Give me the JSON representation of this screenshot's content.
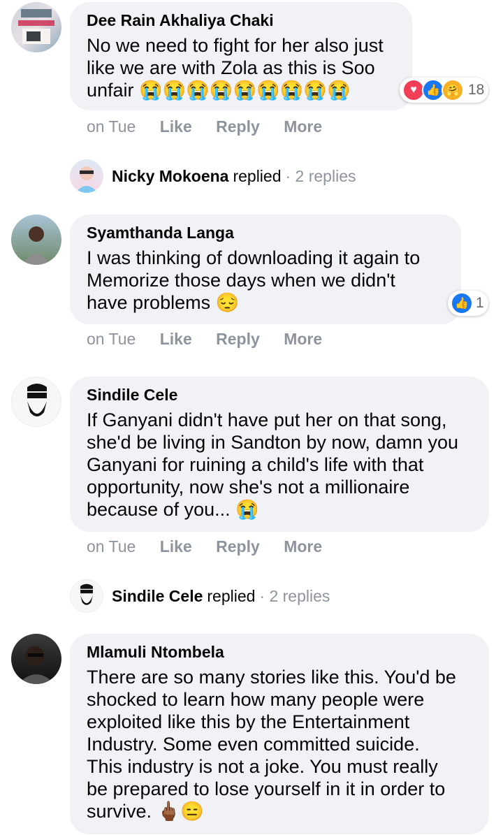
{
  "comments": [
    {
      "name": "Dee Rain Akhaliya Chaki",
      "lines": [
        "No we need to fight for her also just",
        "like we are with Zola as this is Soo",
        "unfair 😭😭😭😭😭😭😭😭😭"
      ],
      "reactions": "18",
      "time": "on Tue"
    },
    {
      "name": "Syamthanda Langa",
      "lines": [
        "I was thinking of downloading it again to",
        "Memorize those days when we didn't",
        "have problems 😔"
      ],
      "reactions": "1",
      "time": "on Tue"
    },
    {
      "name": "Sindile Cele",
      "lines": [
        "If Ganyani didn't have put her on that song,",
        "she'd be living in Sandton by now, damn you",
        "Ganyani for ruining a child's life with that",
        "opportunity, now she's not a millionaire",
        "because of you... 😭"
      ],
      "time": "on Tue"
    },
    {
      "name": "Mlamuli Ntombela",
      "lines": [
        "There are so many stories like this. You'd be",
        "shocked to learn how many people were",
        "exploited like this by the Entertainment",
        "Industry. Some even committed suicide.",
        "This industry is not a joke. You must really",
        "be prepared to lose yourself in it in order to",
        "survive. 🖕🏾😑"
      ]
    }
  ],
  "actions": {
    "like": "Like",
    "reply": "Reply",
    "more": "More"
  },
  "reply_summaries": [
    {
      "name": "Nicky Mokoena",
      "verb": "replied",
      "count": "· 2 replies"
    },
    {
      "name": "Sindile Cele",
      "verb": "replied",
      "count": "· 2 replies"
    }
  ],
  "icons": [
    "avatar",
    "like-icon",
    "love-icon",
    "care-icon"
  ],
  "colors": {
    "bubble": "#f0f2f5",
    "like": "#1877f2",
    "love": "#f33e58",
    "muted": "#8d949e"
  }
}
